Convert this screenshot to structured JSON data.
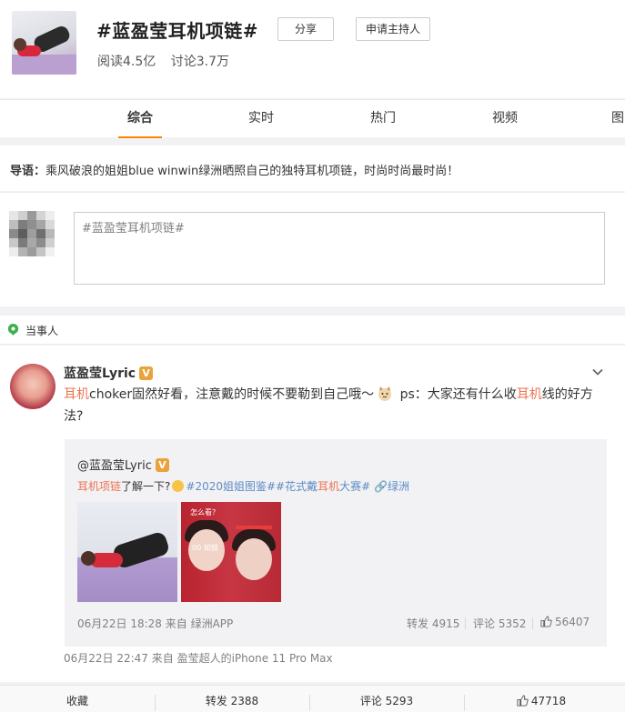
{
  "topic": {
    "title": "#蓝盈莹耳机项链#",
    "reads": "阅读4.5亿",
    "discussions": "讨论3.7万",
    "share_label": "分享",
    "apply_host_label": "申请主持人"
  },
  "tabs": [
    {
      "label": "综合",
      "active": true
    },
    {
      "label": "实时",
      "active": false
    },
    {
      "label": "热门",
      "active": false
    },
    {
      "label": "视频",
      "active": false
    },
    {
      "label": "图",
      "active": false
    }
  ],
  "guide": {
    "prefix": "导语：",
    "text": "乘风破浪的姐姐blue winwin绿洲晒照自己的独特耳机项链，时尚时尚最时尚！"
  },
  "composer": {
    "value": "#蓝盈莹耳机项链#"
  },
  "person_section": {
    "label": "当事人"
  },
  "post": {
    "author": "蓝盈莹Lyric",
    "text_hl1": "耳机",
    "text_part1": "choker固然好看，注意戴的时候不要勒到自己哦～",
    "text_part2": " ps：大家还有什么收",
    "text_hl2": "耳机",
    "text_part3": "线的好方法?",
    "meta": "06月22日 22:47  来自 盈莹超人的iPhone 11 Pro Max",
    "repost": {
      "author": "@蓝盈莹Lyric",
      "text_link": "耳机项链",
      "text_mid": "了解一下?",
      "tag1": "#2020姐姐图鉴#",
      "tag2_a": "#花式戴",
      "tag2_hl": "耳机",
      "tag2_b": "大赛#",
      "location": "绿洲",
      "meta": "06月22日 18:28 来自 绿洲APP",
      "forward": "转发 4915",
      "comment": "评论 5352",
      "like": "56407",
      "photo2_cap1": "怎么看？",
      "photo2_cap2": "00 如鼓"
    }
  },
  "actions": {
    "collect": "收藏",
    "forward": "转发 2388",
    "comment": "评论 5293",
    "like": "47718"
  },
  "colors": {
    "accent": "#ff8200",
    "highlight": "#eb7350",
    "tag": "#5d8cc4",
    "vip_badge": "#e8a33d"
  }
}
